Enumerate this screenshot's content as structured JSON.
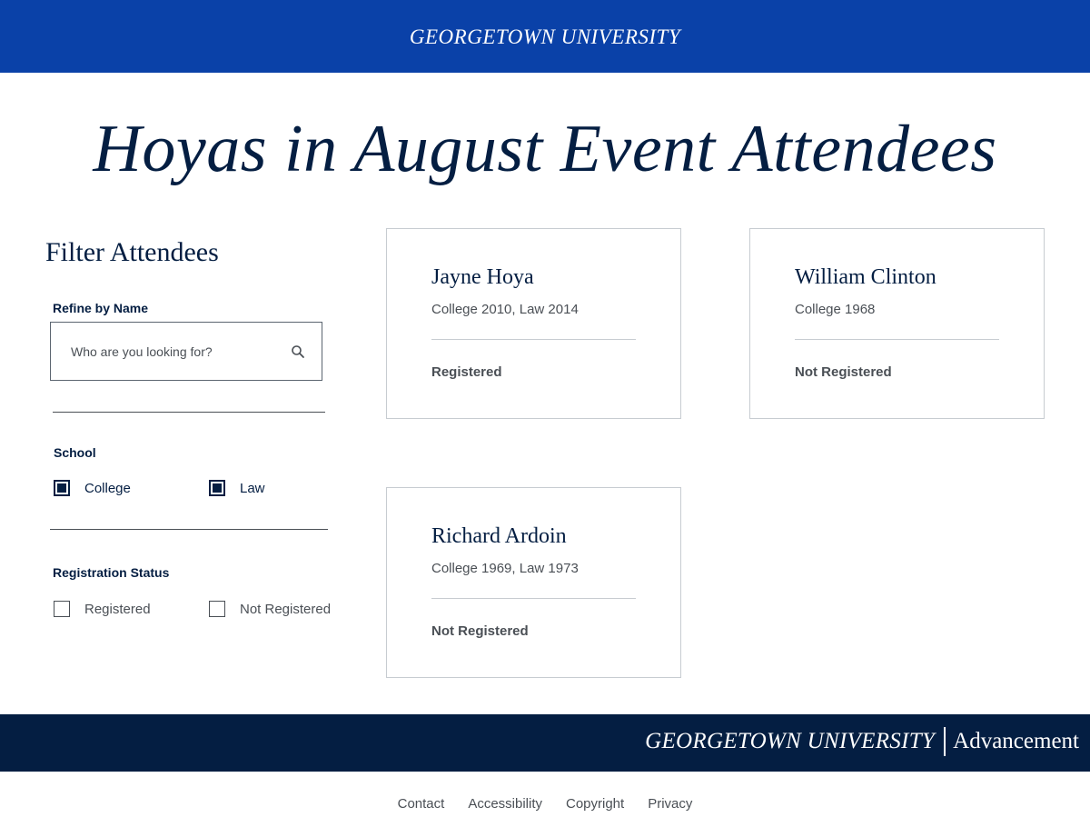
{
  "header": {
    "logo_text": "GEORGETOWN UNIVERSITY"
  },
  "page": {
    "title": "Hoyas in August Event Attendees"
  },
  "filters": {
    "heading": "Filter Attendees",
    "name_label": "Refine by Name",
    "search_placeholder": "Who are you looking for?",
    "school_label": "School",
    "school_options": [
      {
        "label": "College",
        "checked": true
      },
      {
        "label": "Law",
        "checked": true
      }
    ],
    "status_label": "Registration Status",
    "status_options": [
      {
        "label": "Registered",
        "checked": false
      },
      {
        "label": "Not Registered",
        "checked": false
      }
    ]
  },
  "attendees": [
    {
      "name": "Jayne Hoya",
      "detail": "College 2010, Law 2014",
      "status": "Registered"
    },
    {
      "name": "William Clinton",
      "detail": "College 1968",
      "status": "Not Registered"
    },
    {
      "name": "Richard Ardoin",
      "detail": "College 1969, Law 1973",
      "status": "Not Registered"
    }
  ],
  "footer": {
    "logo_university": "GEORGETOWN UNIVERSITY",
    "logo_unit": "Advancement",
    "links": [
      "Contact",
      "Accessibility",
      "Copyright",
      "Privacy"
    ]
  },
  "colors": {
    "brand_blue": "#0a41a8",
    "navy": "#041e42",
    "text_gray": "#4a4f55"
  }
}
